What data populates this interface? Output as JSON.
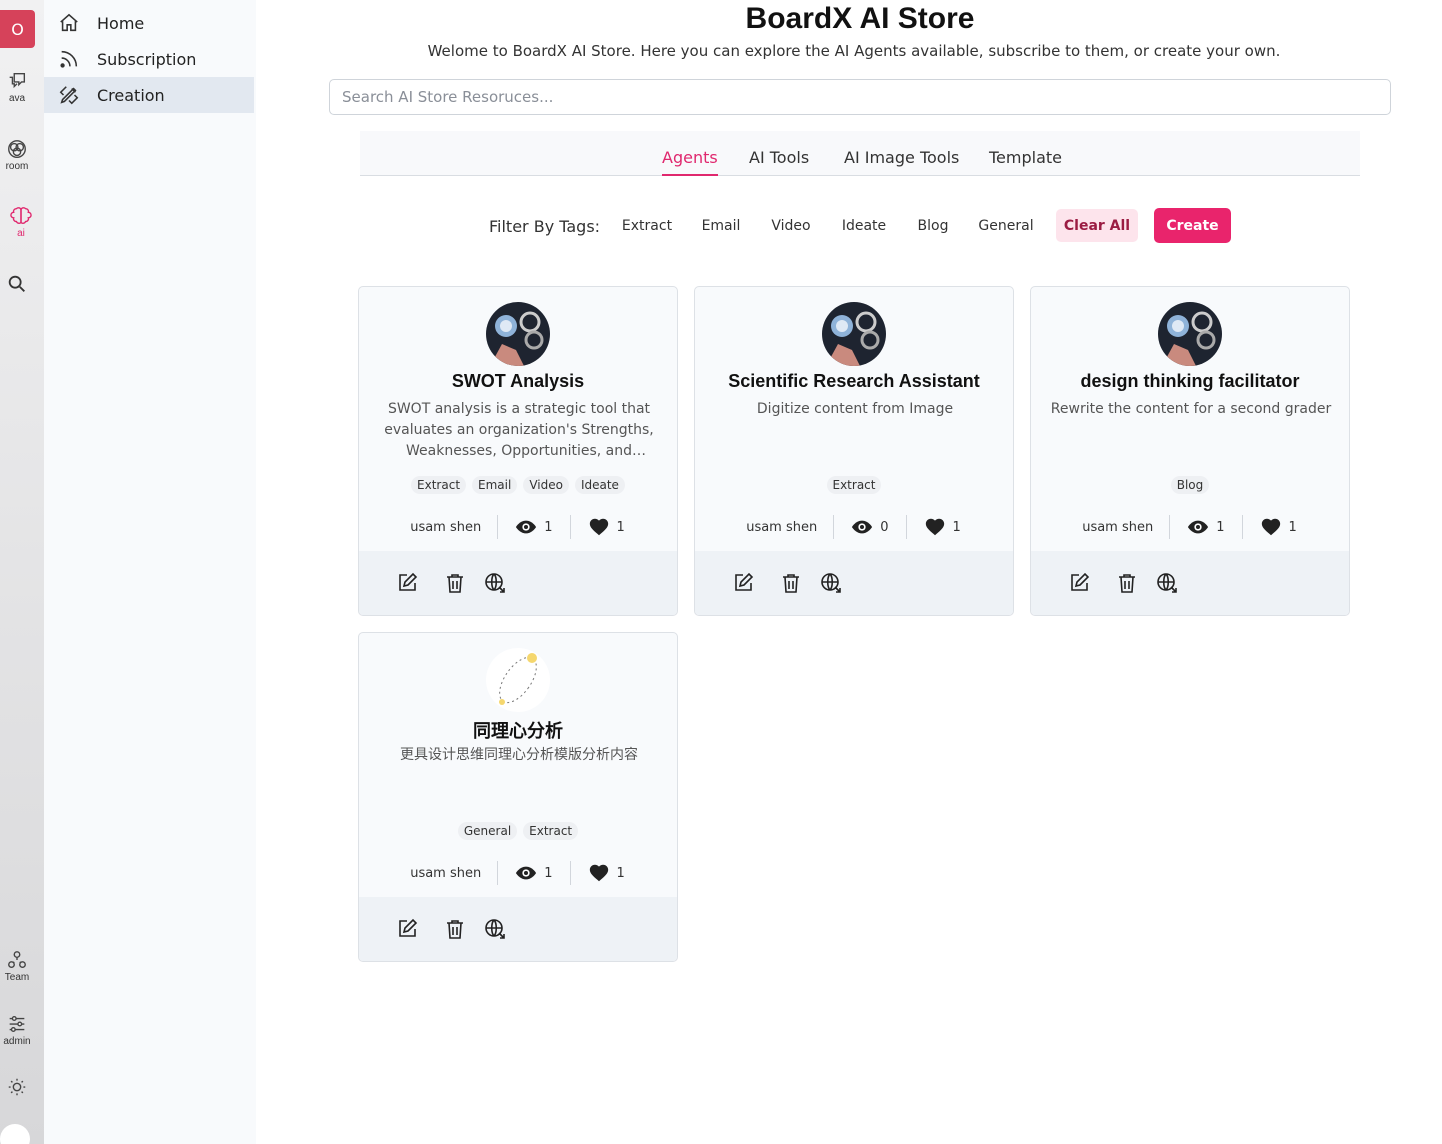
{
  "rail": {
    "avatar_letter": "O",
    "items": [
      {
        "label": "ava",
        "icon": "chat-icon"
      },
      {
        "label": "room",
        "icon": "room-icon"
      },
      {
        "label": "ai",
        "icon": "brain-icon"
      },
      {
        "label": "",
        "icon": "search-icon"
      },
      {
        "label": "Team",
        "icon": "team-icon"
      },
      {
        "label": "admin",
        "icon": "sliders-icon"
      },
      {
        "label": "",
        "icon": "sun-icon"
      }
    ],
    "accent": "#e0286e"
  },
  "sidebar": {
    "items": [
      {
        "label": "Home",
        "icon": "home-icon"
      },
      {
        "label": "Subscription",
        "icon": "rss-icon"
      },
      {
        "label": "Creation",
        "icon": "pencil-ruler-icon",
        "active": true
      }
    ]
  },
  "header": {
    "title": "BoardX AI Store",
    "subtitle": "Welome to BoardX AI Store. Here you can explore the AI Agents available, subscribe to them, or create your own."
  },
  "search": {
    "placeholder": "Search AI Store Resoruces..."
  },
  "tabs": [
    {
      "label": "Agents",
      "active": true
    },
    {
      "label": "AI Tools"
    },
    {
      "label": "AI Image Tools"
    },
    {
      "label": "Template"
    }
  ],
  "filters": {
    "label": "Filter By Tags:",
    "tags": [
      "Extract",
      "Email",
      "Video",
      "Ideate",
      "Blog",
      "General"
    ],
    "clear_label": "Clear All",
    "create_label": "Create"
  },
  "cards": [
    {
      "title": "SWOT Analysis",
      "description": "SWOT analysis is a strategic tool that evaluates an organization's Strengths, Weaknesses, Opportunities, and Threats.",
      "tags": [
        "Extract",
        "Email",
        "Video",
        "Ideate"
      ],
      "author": "usam shen",
      "views": "1",
      "likes": "1"
    },
    {
      "title": "Scientific Research Assistant",
      "description": "Digitize content from Image",
      "tags": [
        "Extract"
      ],
      "author": "usam shen",
      "views": "0",
      "likes": "1"
    },
    {
      "title": "design thinking facilitator",
      "description": "Rewrite the content for a second grader",
      "tags": [
        "Blog"
      ],
      "author": "usam shen",
      "views": "1",
      "likes": "1"
    },
    {
      "title": "同理心分析",
      "description": "更具设计思维同理心分析模版分析内容",
      "tags": [
        "General",
        "Extract"
      ],
      "author": "usam shen",
      "views": "1",
      "likes": "1"
    }
  ],
  "colors": {
    "accent": "#e0286e",
    "create": "#e9246c",
    "clear_bg": "#fde4ec"
  }
}
